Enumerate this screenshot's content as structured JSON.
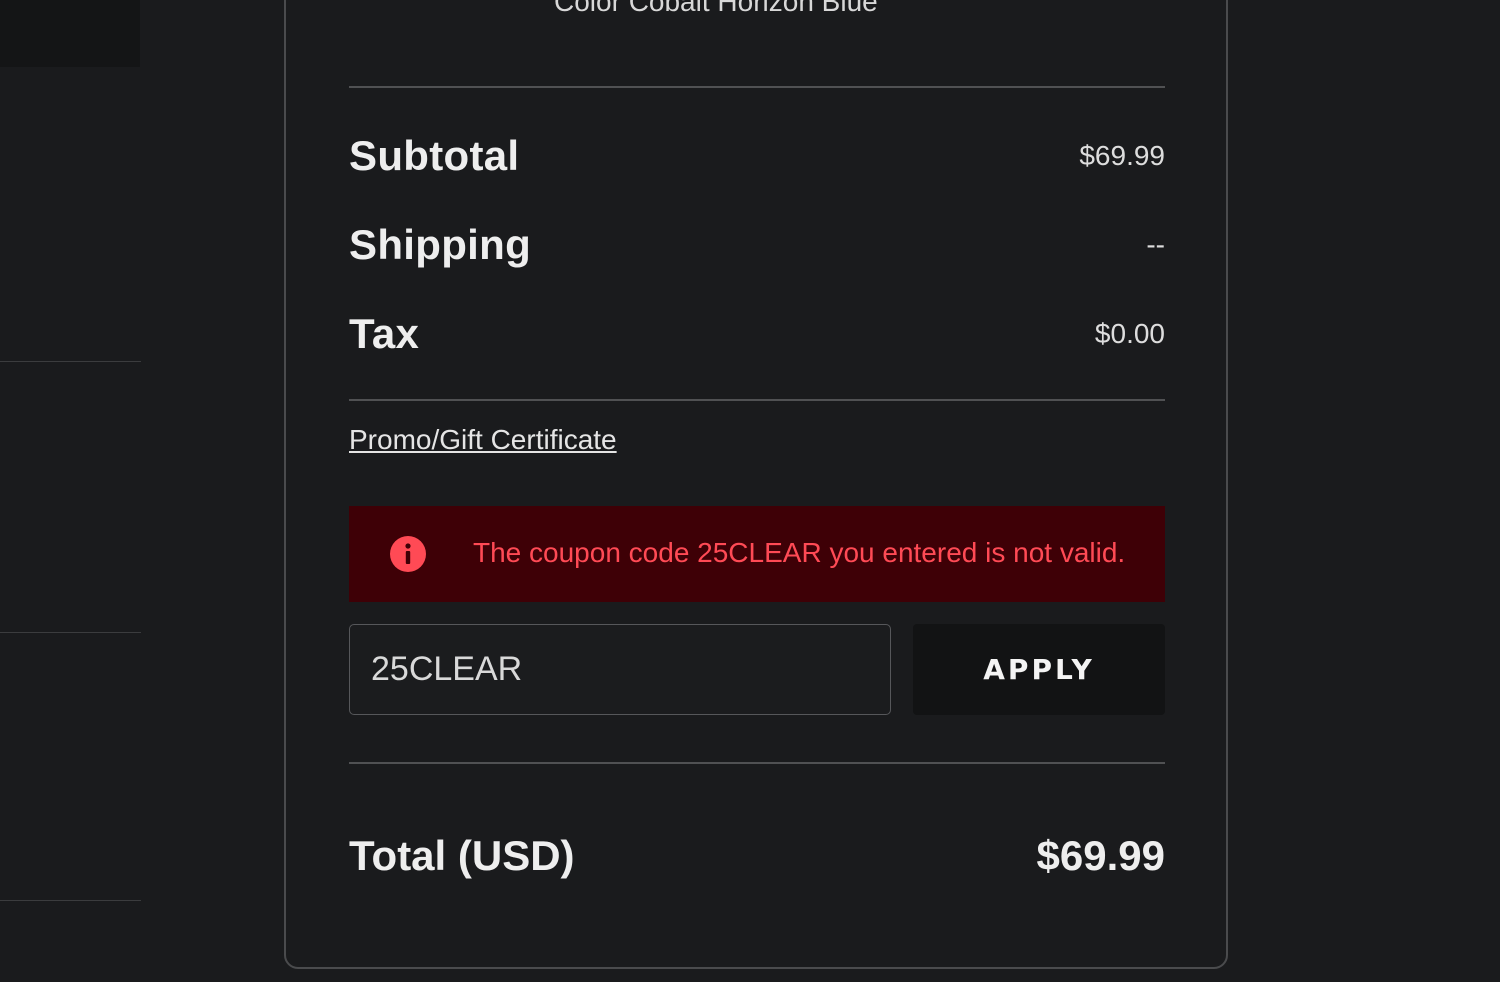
{
  "order_summary": {
    "item_color_line": "Color Cobalt Horizon Blue",
    "subtotal_label": "Subtotal",
    "subtotal_value": "$69.99",
    "shipping_label": "Shipping",
    "shipping_value": "--",
    "tax_label": "Tax",
    "tax_value": "$0.00",
    "promo_link": "Promo/Gift Certificate",
    "alert": {
      "icon": "info-circle-icon",
      "message": "The coupon code 25CLEAR you entered is not valid.",
      "color": "#ff4a55",
      "background": "#3e0006"
    },
    "coupon": {
      "value": "25CLEAR",
      "apply_label": "APPLY"
    },
    "total_label": "Total (USD)",
    "total_value": "$69.99"
  }
}
